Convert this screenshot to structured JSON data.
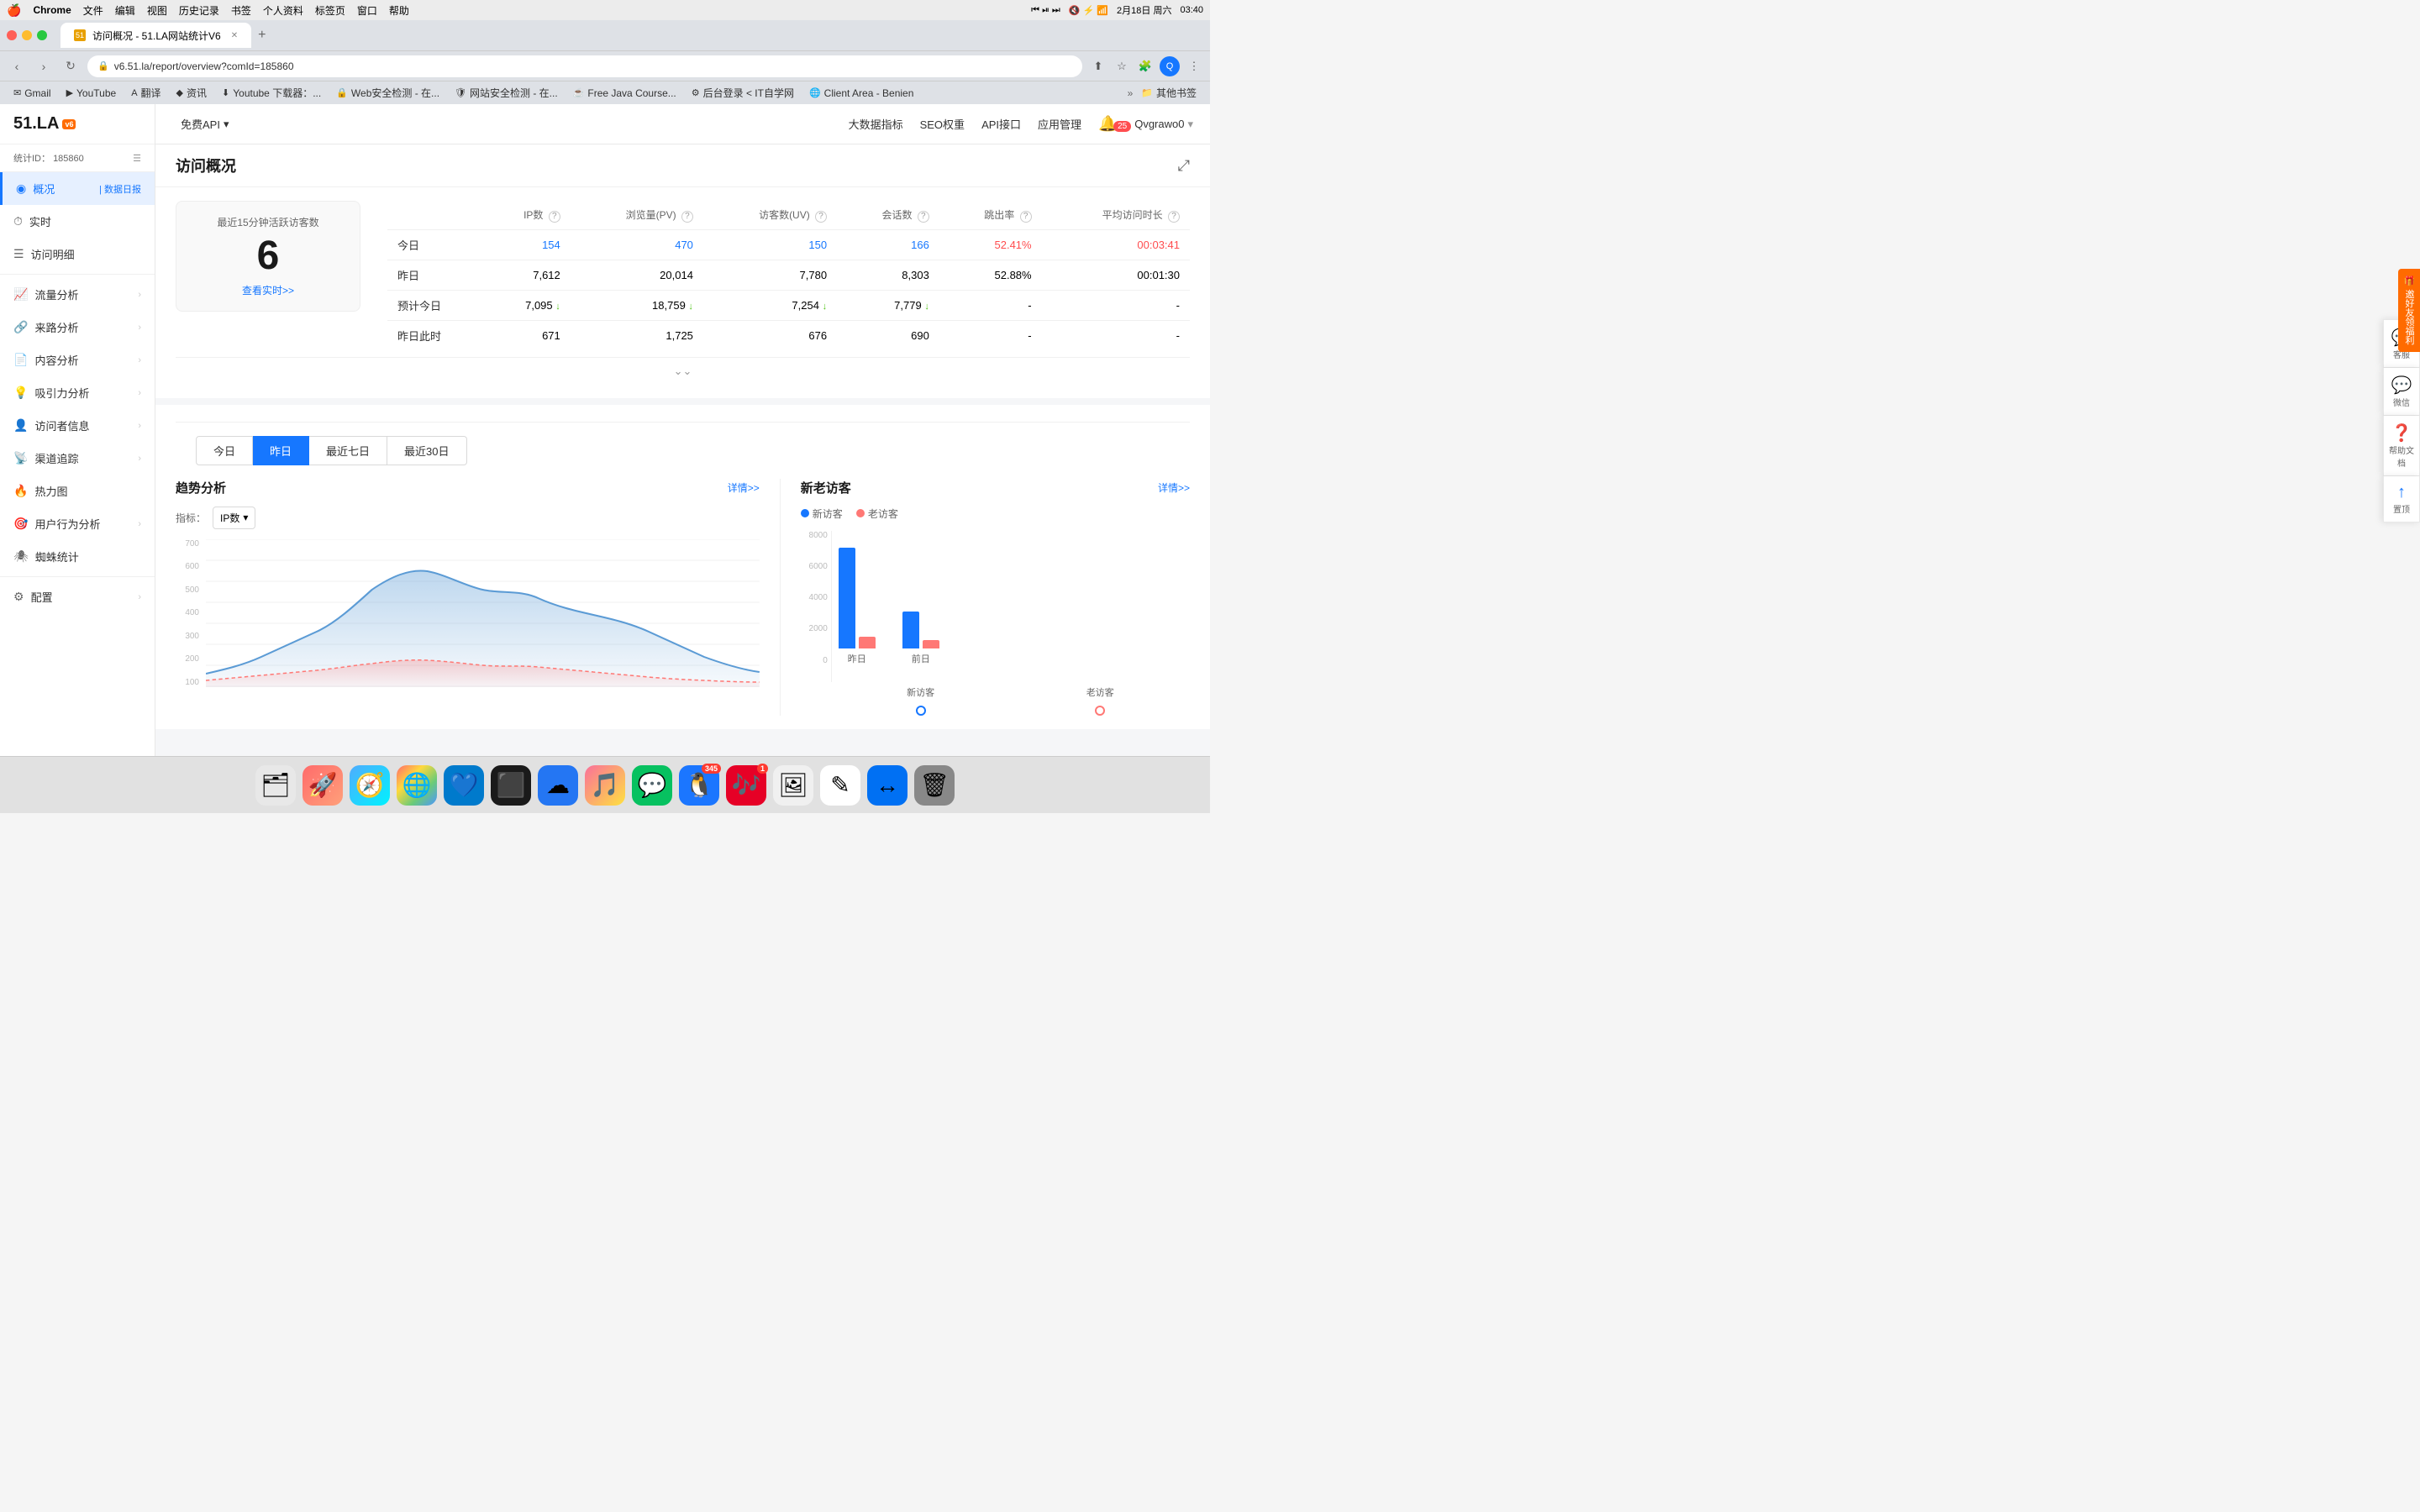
{
  "menubar": {
    "apple": "🍎",
    "items": [
      "Chrome",
      "文件",
      "编辑",
      "视图",
      "历史记录",
      "书签",
      "个人资料",
      "标签页",
      "窗口",
      "帮助"
    ],
    "right_items": [
      "2月18日 周六",
      "03:40"
    ]
  },
  "chrome": {
    "tab_title": "访问概况 - 51.LA网站统计V6",
    "url": "v6.51.la/report/overview?comId=185860",
    "new_tab": "+",
    "nav": {
      "back": "‹",
      "forward": "›",
      "refresh": "↻"
    }
  },
  "bookmarks": [
    {
      "label": "Gmail",
      "icon": "✉"
    },
    {
      "label": "YouTube",
      "icon": "▶"
    },
    {
      "label": "翻译",
      "icon": "A"
    },
    {
      "label": "资讯",
      "icon": "◆"
    },
    {
      "label": "Youtube 下载器：...",
      "icon": "⬇"
    },
    {
      "label": "Web安全检测 - 在...",
      "icon": "🔒"
    },
    {
      "label": "网站安全检测 - 在...",
      "icon": "🛡"
    },
    {
      "label": "Free Java Course...",
      "icon": "☕"
    },
    {
      "label": "后台登录 < IT自学网",
      "icon": "⚙"
    },
    {
      "label": "Client Area - Benien",
      "icon": "🌐"
    },
    {
      "label": "其他书签",
      "icon": "📁"
    }
  ],
  "sidebar": {
    "logo": "51.LA",
    "logo_v6": "v6",
    "stat_id_label": "统计ID：",
    "stat_id": "185860",
    "nav_items": [
      {
        "id": "overview",
        "label": "概况",
        "icon": "◉",
        "active": true,
        "has_arrow": false
      },
      {
        "id": "realtime",
        "label": "实时",
        "icon": "⏱",
        "active": false,
        "has_arrow": false
      },
      {
        "id": "visit_detail",
        "label": "访问明细",
        "icon": "☰",
        "active": false,
        "has_arrow": false
      },
      {
        "id": "traffic",
        "label": "流量分析",
        "icon": "📈",
        "active": false,
        "has_arrow": true
      },
      {
        "id": "source",
        "label": "来路分析",
        "icon": "🔗",
        "active": false,
        "has_arrow": true
      },
      {
        "id": "content",
        "label": "内容分析",
        "icon": "📄",
        "active": false,
        "has_arrow": true
      },
      {
        "id": "attract",
        "label": "吸引力分析",
        "icon": "💡",
        "active": false,
        "has_arrow": true
      },
      {
        "id": "visitor",
        "label": "访问者信息",
        "icon": "👤",
        "active": false,
        "has_arrow": true
      },
      {
        "id": "channel",
        "label": "渠道追踪",
        "icon": "📡",
        "active": false,
        "has_arrow": true
      },
      {
        "id": "heatmap",
        "label": "热力图",
        "icon": "🔥",
        "active": false,
        "has_arrow": false
      },
      {
        "id": "behavior",
        "label": "用户行为分析",
        "icon": "🎯",
        "active": false,
        "has_arrow": true
      },
      {
        "id": "spider",
        "label": "蜘蛛统计",
        "icon": "🕷",
        "active": false,
        "has_arrow": false
      },
      {
        "id": "config",
        "label": "配置",
        "icon": "⚙",
        "active": false,
        "has_arrow": true
      }
    ]
  },
  "topnav": {
    "free_api": "免费API",
    "arrow": "▾",
    "links": [
      "大数据指标",
      "SEO权重",
      "API接口",
      "应用管理"
    ],
    "user": "Qvgrawo0",
    "notification_count": "25"
  },
  "page": {
    "title": "访问概况",
    "share_icon": "⤢",
    "overview_tab": "概况",
    "daily_tab": "数据日报",
    "separator": "|"
  },
  "realtime": {
    "label": "最近15分钟活跃访客数",
    "count": "6",
    "link": "查看实时>>"
  },
  "stats_table": {
    "headers": [
      "",
      "IP数",
      "浏览量(PV)",
      "访客数(UV)",
      "会话数",
      "跳出率",
      "平均访问时长"
    ],
    "rows": [
      {
        "label": "今日",
        "ip": "154",
        "pv": "470",
        "uv": "150",
        "session": "166",
        "bounce": "52.41%",
        "avg_time": "00:03:41",
        "highlight": true
      },
      {
        "label": "昨日",
        "ip": "7,612",
        "pv": "20,014",
        "uv": "7,780",
        "session": "8,303",
        "bounce": "52.88%",
        "avg_time": "00:01:30",
        "highlight": false
      },
      {
        "label": "预计今日",
        "ip": "7,095",
        "pv": "18,759",
        "uv": "7,254",
        "session": "7,779",
        "bounce": "-",
        "avg_time": "-",
        "highlight": false,
        "trend": "down"
      },
      {
        "label": "昨日此时",
        "ip": "671",
        "pv": "1,725",
        "uv": "676",
        "session": "690",
        "bounce": "-",
        "avg_time": "-",
        "highlight": false
      }
    ]
  },
  "date_tabs": [
    "今日",
    "昨日",
    "最近七日",
    "最近30日"
  ],
  "active_date_tab": 1,
  "trend_chart": {
    "title": "趋势分析",
    "detail": "详情>>",
    "metric_label": "指标：",
    "metric_value": "IP数",
    "y_labels": [
      "700",
      "600",
      "500",
      "400",
      "300",
      "200",
      "100"
    ]
  },
  "visitors_chart": {
    "title": "新老访客",
    "detail": "详情>>",
    "legend": [
      {
        "label": "新访客",
        "color": "#1677ff"
      },
      {
        "label": "老访客",
        "color": "#ff7875"
      }
    ],
    "y_labels": [
      "8000",
      "6000",
      "4000",
      "2000",
      "0"
    ],
    "bars": [
      {
        "label": "昨日",
        "new_height": 120,
        "old_height": 15
      },
      {
        "label": "前日",
        "new_height": 45,
        "old_height": 12
      }
    ],
    "sub_labels": [
      "新访客",
      "老访客"
    ]
  },
  "float_buttons": [
    {
      "id": "customer",
      "icon": "💬",
      "label": "客服"
    },
    {
      "id": "wechat",
      "icon": "💬",
      "label": "微信"
    },
    {
      "id": "help",
      "icon": "❓",
      "label": "帮助文档"
    },
    {
      "id": "top",
      "icon": "↑",
      "label": "置顶"
    }
  ],
  "invite_banner": {
    "icon": "🎁",
    "text": "邀好友领福利"
  },
  "dock_items": [
    {
      "id": "finder",
      "icon": "🗂",
      "label": "Finder"
    },
    {
      "id": "launchpad",
      "icon": "🚀",
      "label": "Launchpad"
    },
    {
      "id": "safari",
      "icon": "🧭",
      "label": "Safari"
    },
    {
      "id": "chrome",
      "icon": "🌐",
      "label": "Chrome"
    },
    {
      "id": "vscode",
      "icon": "💙",
      "label": "VSCode"
    },
    {
      "id": "terminal",
      "icon": "⬛",
      "label": "Terminal"
    },
    {
      "id": "baidu",
      "icon": "☁",
      "label": "Baidu"
    },
    {
      "id": "music",
      "icon": "🎵",
      "label": "Music"
    },
    {
      "id": "wechat_dock",
      "icon": "💬",
      "label": "WeChat",
      "badge": ""
    },
    {
      "id": "qq",
      "icon": "🐧",
      "label": "QQ"
    },
    {
      "id": "netease",
      "icon": "🎶",
      "label": "NetEase"
    },
    {
      "id": "preview",
      "icon": "🖼",
      "label": "Preview"
    },
    {
      "id": "bbedit",
      "icon": "✎",
      "label": "BBEdit"
    },
    {
      "id": "teleport",
      "icon": "↔",
      "label": "Teleport"
    },
    {
      "id": "trash",
      "icon": "🗑",
      "label": "Trash"
    }
  ]
}
